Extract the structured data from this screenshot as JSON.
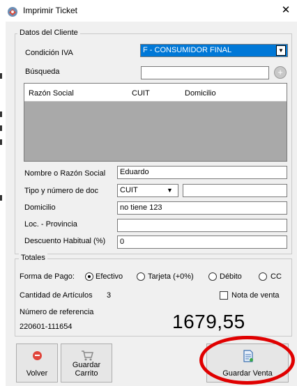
{
  "window": {
    "title": "Imprimir Ticket",
    "close_glyph": "✕",
    "icon": "ticket-app-icon"
  },
  "cliente": {
    "legend": "Datos del Cliente",
    "condicion_label": "Condición IVA",
    "condicion_value": "F - CONSUMIDOR FINAL",
    "busqueda_label": "Búsqueda",
    "busqueda_value": "",
    "grid_columns": [
      "Razón Social",
      "CUIT",
      "Domicilio"
    ],
    "nombre_label": "Nombre o Razón Social",
    "nombre_value": "Eduardo",
    "tipo_doc_label": "Tipo y número de doc",
    "tipo_doc_value": "CUIT",
    "numero_doc_value": "",
    "domicilio_label": "Domicilio",
    "domicilio_value": "no tiene 123",
    "loc_label": "Loc. -  Provincia",
    "loc_value": "",
    "descuento_label": "Descuento Habitual (%)",
    "descuento_value": "0"
  },
  "totales": {
    "legend": "Totales",
    "forma_pago_label": "Forma de Pago:",
    "options": [
      {
        "label": "Efectivo",
        "selected": true
      },
      {
        "label": "Tarjeta (+0%)",
        "selected": false
      },
      {
        "label": "Débito",
        "selected": false
      },
      {
        "label": "CC",
        "selected": false
      }
    ],
    "cantidad_label": "Cantidad de Artículos",
    "cantidad_value": "3",
    "nota_label": "Nota de venta",
    "nota_checked": false,
    "referencia_label": "Número de referencia",
    "referencia_value": "220601-111654",
    "total_value": "1679,55"
  },
  "buttons": {
    "volver": "Volver",
    "guardar_carrito": "Guardar Carrito",
    "guardar_venta": "Guardar Venta"
  },
  "colors": {
    "selection": "#0078d7",
    "grid_bg": "#a9a9a9",
    "highlight_circle": "#e00000",
    "window_bg": "#f0f0f0"
  }
}
